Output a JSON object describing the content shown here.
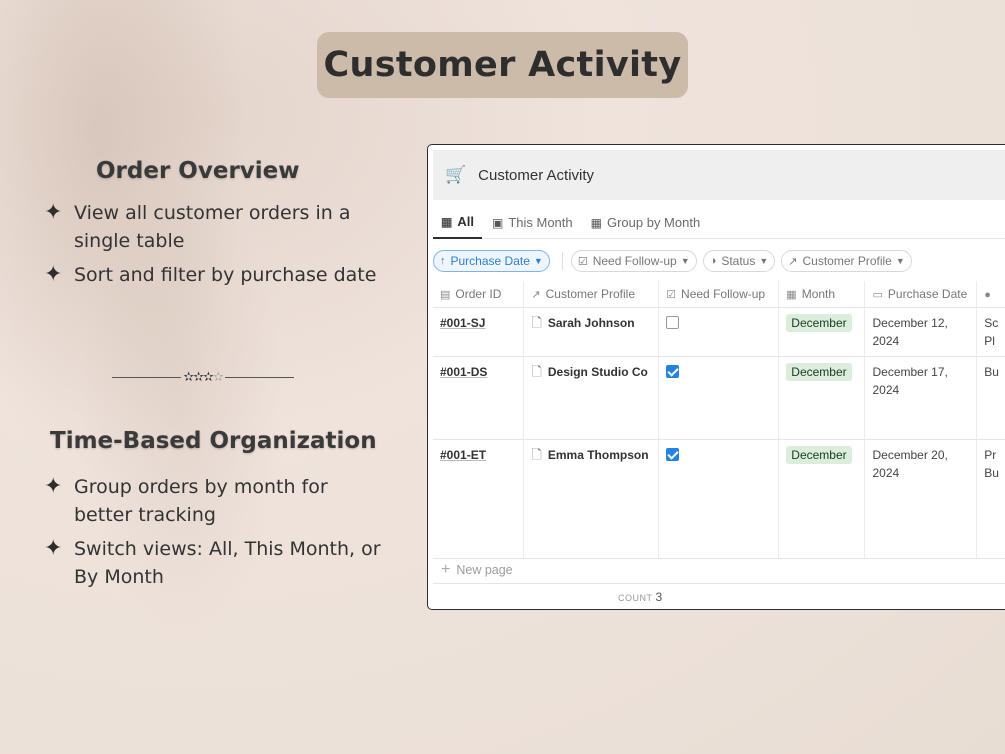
{
  "banner": {
    "title": "Customer Activity"
  },
  "left": {
    "section1": {
      "heading": "Order Overview",
      "bullets": [
        "View all customer orders in a single table",
        "Sort and filter by purchase date"
      ]
    },
    "section2": {
      "heading": "Time-Based Organization",
      "bullets": [
        "Group orders by month for better tracking",
        "Switch views: All, This Month, or By Month"
      ]
    },
    "bullet_glyph": "✦",
    "divider_stars": "✫✫✫",
    "divider_faint_star": "✫"
  },
  "app": {
    "title": "Customer Activity",
    "tabs": [
      {
        "label": "All",
        "active": true
      },
      {
        "label": "This Month",
        "active": false
      },
      {
        "label": "Group by Month",
        "active": false
      }
    ],
    "filters": [
      {
        "label": "Purchase Date",
        "prefix": "↑",
        "active": true
      },
      {
        "label": "Need Follow-up",
        "prefix": "☑"
      },
      {
        "label": "Status",
        "prefix": "◑"
      },
      {
        "label": "Customer Profile",
        "prefix": "↗"
      }
    ],
    "columns": [
      "Order ID",
      "Customer Profile",
      "Need Follow-up",
      "Month",
      "Purchase Date",
      ""
    ],
    "rows": [
      {
        "order_id": "#001-SJ",
        "customer": "Sarah Johnson",
        "follow_up": false,
        "month": "December",
        "date": "December 12, 2024",
        "extra": "Sc Pl"
      },
      {
        "order_id": "#001-DS",
        "customer": "Design Studio Co",
        "follow_up": true,
        "month": "December",
        "date": "December 17, 2024",
        "extra": "Bu"
      },
      {
        "order_id": "#001-ET",
        "customer": "Emma Thompson",
        "follow_up": true,
        "month": "December",
        "date": "December 20, 2024",
        "extra": "Pr Bu"
      }
    ],
    "new_page_label": "New page",
    "count_label": "COUNT",
    "count_value": "3"
  },
  "colors": {
    "background": "#ece1d9",
    "title_pill": "#cdbbaa",
    "tag_bg": "#dbeddb",
    "checkbox_blue": "#2383e2",
    "filter_blue": "#2b7fd0"
  }
}
